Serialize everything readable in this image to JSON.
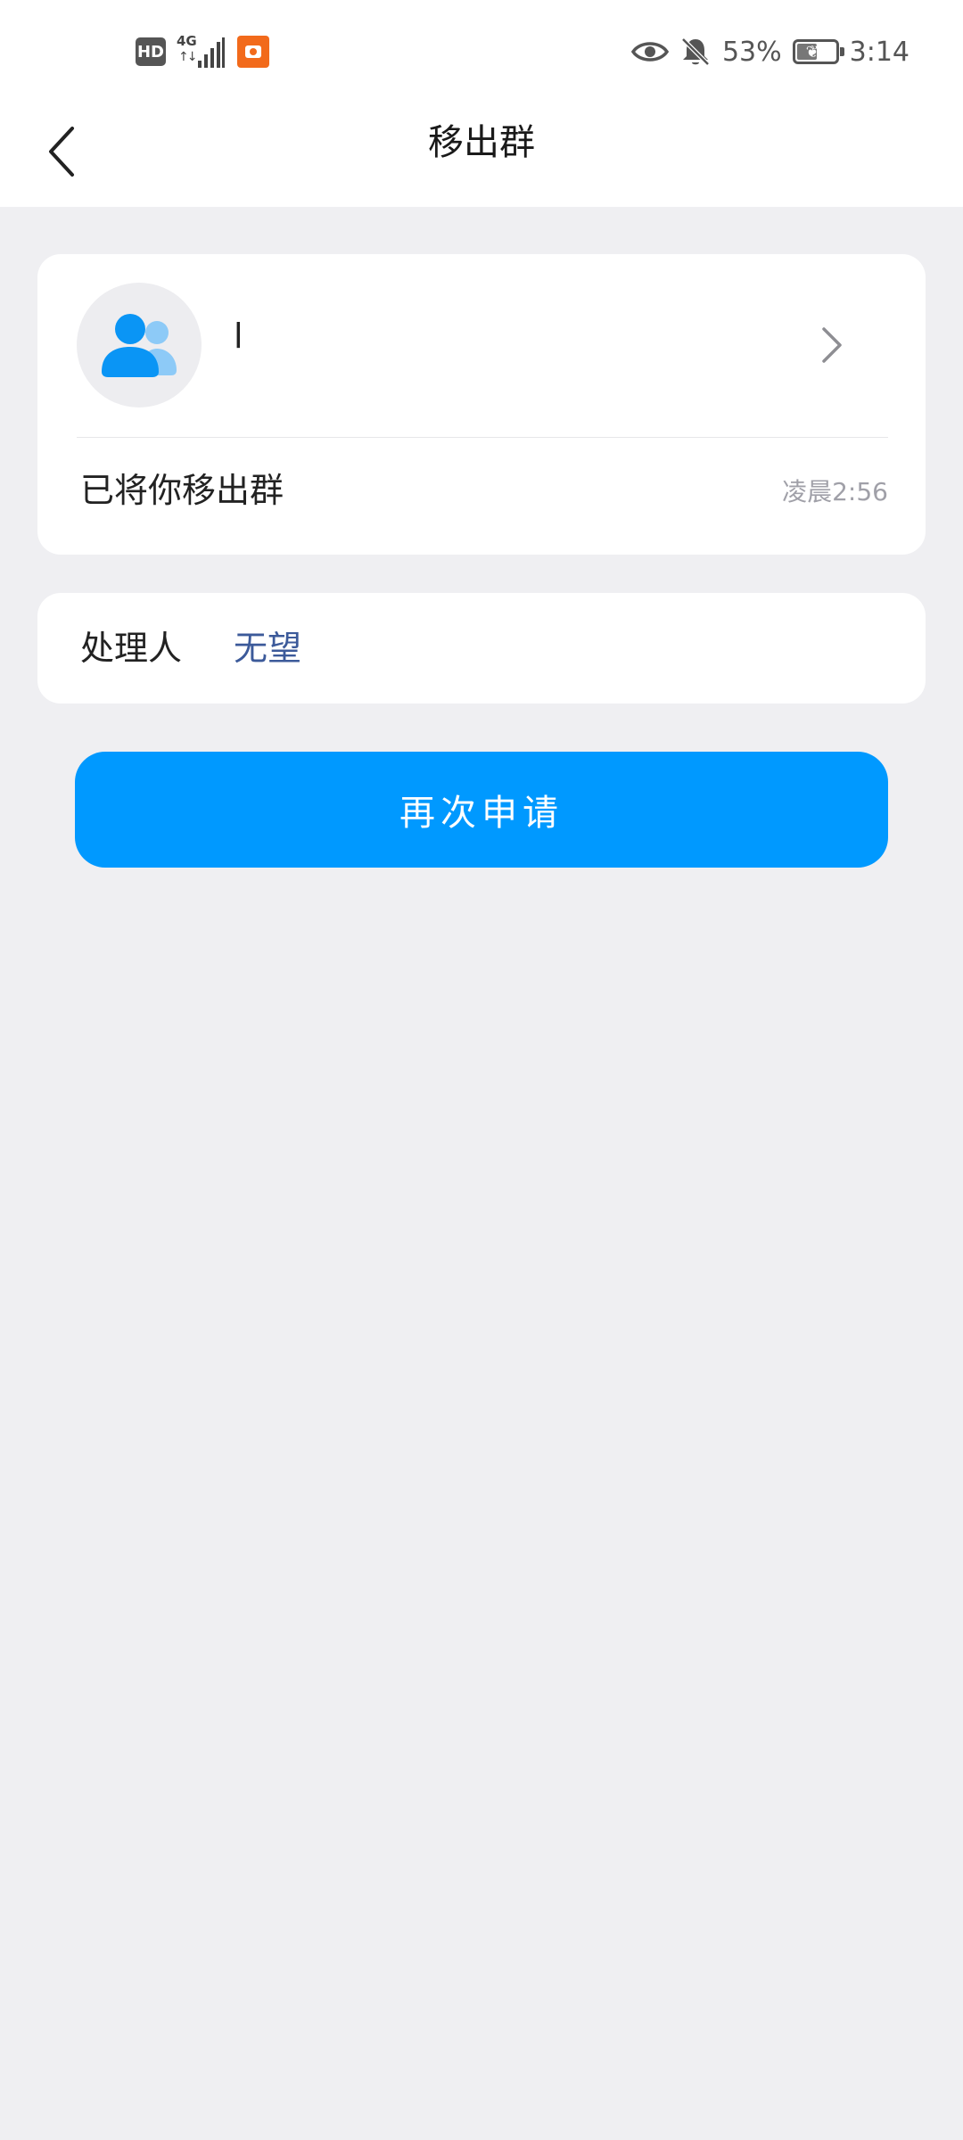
{
  "status_bar": {
    "hd_label": "HD",
    "network_label": "4G",
    "battery_percent": "53%",
    "battery_level": 0.53,
    "time": "3:14",
    "icons": [
      "hd-icon",
      "signal-icon",
      "app-notification-icon",
      "eye-icon",
      "bell-muted-icon",
      "battery-icon"
    ]
  },
  "header": {
    "title": "移出群",
    "back_icon": "chevron-left-icon"
  },
  "group_card": {
    "name": "l",
    "avatar_icon": "group-people-icon",
    "message": "已将你移出群",
    "time": "凌晨2:56"
  },
  "handler": {
    "label": "处理人",
    "value": "无望"
  },
  "actions": {
    "reapply_label": "再次申请"
  },
  "colors": {
    "accent": "#0099ff",
    "link": "#3c5a9a",
    "background": "#efeff2",
    "card": "#ffffff"
  }
}
